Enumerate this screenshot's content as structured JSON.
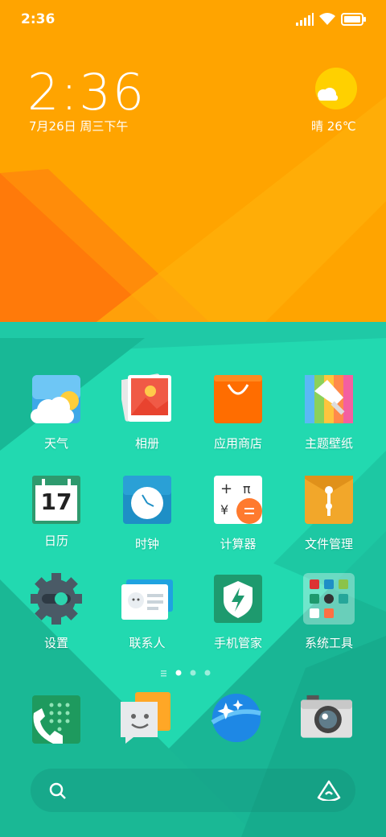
{
  "status_bar": {
    "time": "2:36"
  },
  "lock_widget": {
    "clock": "2:36",
    "date": "7月26日 周三下午",
    "weather": "晴 26℃"
  },
  "apps": [
    {
      "label": "天气",
      "icon": "weather-icon"
    },
    {
      "label": "相册",
      "icon": "gallery-icon"
    },
    {
      "label": "应用商店",
      "icon": "app-store-icon"
    },
    {
      "label": "主题壁纸",
      "icon": "themes-icon"
    },
    {
      "label": "日历",
      "icon": "calendar-icon",
      "number": "17"
    },
    {
      "label": "时钟",
      "icon": "clock-icon"
    },
    {
      "label": "计算器",
      "icon": "calculator-icon"
    },
    {
      "label": "文件管理",
      "icon": "file-manager-icon"
    },
    {
      "label": "设置",
      "icon": "settings-icon"
    },
    {
      "label": "联系人",
      "icon": "contacts-icon"
    },
    {
      "label": "手机管家",
      "icon": "security-icon"
    },
    {
      "label": "系统工具",
      "icon": "system-tools-folder-icon"
    }
  ],
  "dock": [
    {
      "icon": "phone-icon"
    },
    {
      "icon": "messages-icon"
    },
    {
      "icon": "browser-icon"
    },
    {
      "icon": "camera-icon"
    }
  ],
  "colors": {
    "top_orange": "#FFA400",
    "top_dark_orange": "#FF7A0A",
    "bottom_teal": "#22D9B0",
    "bottom_dark_teal": "#14A88A"
  }
}
